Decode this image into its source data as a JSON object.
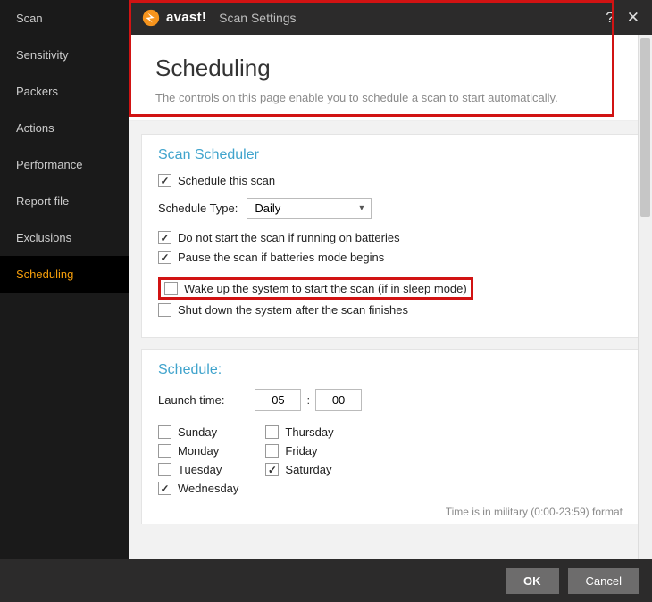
{
  "titlebar": {
    "brand": "avast!",
    "subtitle": "Scan Settings"
  },
  "sidebar": {
    "items": [
      {
        "label": "Scan"
      },
      {
        "label": "Sensitivity"
      },
      {
        "label": "Packers"
      },
      {
        "label": "Actions"
      },
      {
        "label": "Performance"
      },
      {
        "label": "Report file"
      },
      {
        "label": "Exclusions"
      },
      {
        "label": "Scheduling"
      }
    ]
  },
  "header": {
    "title": "Scheduling",
    "desc": "The controls on this page enable you to schedule a scan to start automatically."
  },
  "scheduler": {
    "title": "Scan Scheduler",
    "schedule_this": "Schedule this scan",
    "type_label": "Schedule Type:",
    "type_value": "Daily",
    "no_batteries": "Do not start the scan if running on batteries",
    "pause_batteries": "Pause the scan if batteries mode begins",
    "wake": "Wake up the system to start the scan (if in sleep mode)",
    "shutdown": "Shut down the system after the scan finishes"
  },
  "schedule": {
    "title": "Schedule:",
    "launch_label": "Launch time:",
    "hour": "05",
    "minute": "00",
    "days": {
      "sunday": "Sunday",
      "monday": "Monday",
      "tuesday": "Tuesday",
      "wednesday": "Wednesday",
      "thursday": "Thursday",
      "friday": "Friday",
      "saturday": "Saturday"
    },
    "note": "Time is in military (0:00-23:59) format"
  },
  "buttons": {
    "ok": "OK",
    "cancel": "Cancel"
  }
}
